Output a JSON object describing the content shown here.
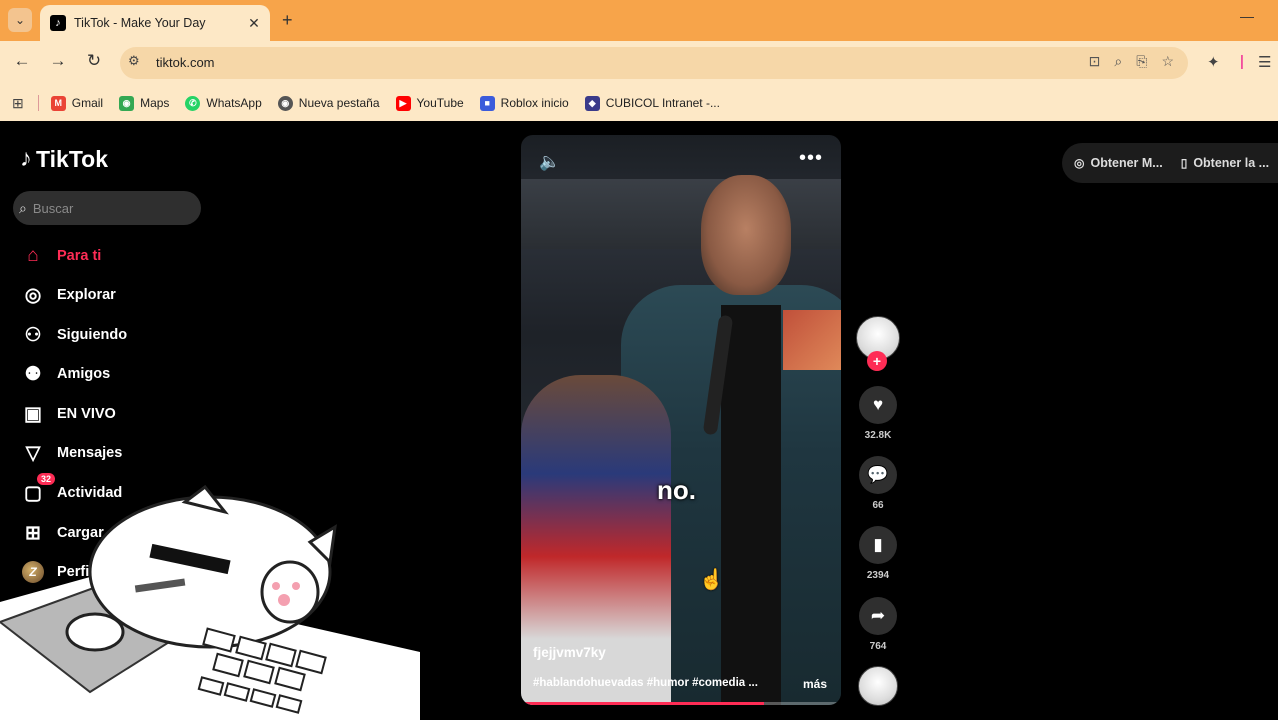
{
  "browser": {
    "tab_title": "TikTok - Make Your Day",
    "url": "tiktok.com",
    "new_tab_symbol": "+",
    "close_symbol": "✕",
    "bookmarks": [
      {
        "label": "Gmail",
        "icon": "gmail-icon",
        "color": "#ea4335",
        "glyph": "M"
      },
      {
        "label": "Maps",
        "icon": "maps-icon",
        "color": "#34a853",
        "glyph": "⬤"
      },
      {
        "label": "WhatsApp",
        "icon": "whatsapp-icon",
        "color": "#25d366",
        "glyph": "✆"
      },
      {
        "label": "Nueva pestaña",
        "icon": "new-tab-icon",
        "color": "#555555",
        "glyph": "◉"
      },
      {
        "label": "YouTube",
        "icon": "youtube-icon",
        "color": "#ff0000",
        "glyph": "▶"
      },
      {
        "label": "Roblox inicio",
        "icon": "roblox-icon",
        "color": "#3b5bdb",
        "glyph": "■"
      },
      {
        "label": "CUBICOL Intranet -...",
        "icon": "cubicol-icon",
        "color": "#3a3a8a",
        "glyph": "◆"
      }
    ]
  },
  "tiktok": {
    "brand": "TikTok",
    "search_placeholder": "Buscar",
    "nav": [
      {
        "label": "Para ti",
        "icon": "home-icon",
        "glyph": "⌂",
        "active": true
      },
      {
        "label": "Explorar",
        "icon": "compass-icon",
        "glyph": "◎",
        "active": false
      },
      {
        "label": "Siguiendo",
        "icon": "following-icon",
        "glyph": "⚇",
        "active": false
      },
      {
        "label": "Amigos",
        "icon": "friends-icon",
        "glyph": "⚉",
        "active": false
      },
      {
        "label": "EN VIVO",
        "icon": "live-icon",
        "glyph": "▣",
        "active": false
      },
      {
        "label": "Mensajes",
        "icon": "messages-icon",
        "glyph": "▽",
        "active": false
      },
      {
        "label": "Actividad",
        "icon": "activity-icon",
        "glyph": "▢",
        "active": false,
        "badge": "32"
      },
      {
        "label": "Cargar",
        "icon": "upload-icon",
        "glyph": "⊞",
        "active": false
      },
      {
        "label": "Perfil",
        "icon": "profile-avatar",
        "glyph": "Z",
        "active": false
      }
    ],
    "top_right": {
      "get_app_label": "Obtener M...",
      "get_app2_label": "Obtener la ..."
    },
    "video": {
      "caption_word": "no.",
      "author": "fjejjvmv7ky",
      "hashtags": "#hablandohuevadas #humor #comedia ...",
      "more_label": "más",
      "progress": 0.76
    },
    "actions": {
      "likes": "32.8K",
      "comments": "66",
      "saves": "2394",
      "shares": "764"
    }
  },
  "colors": {
    "tab_bar": "#f7a44a",
    "toolbar": "#fde8c6",
    "tiktok_red": "#fe2c55"
  }
}
